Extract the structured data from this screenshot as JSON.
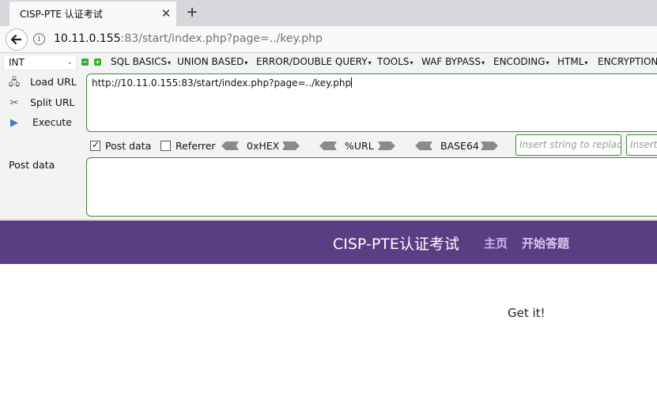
{
  "browser": {
    "tab_title": "CISP-PTE 认证考试",
    "tab_close": "✕",
    "new_tab": "+",
    "url_host": "10.11.0.155",
    "url_rest": ":83/start/index.php?page=../key.php",
    "info_glyph": "i"
  },
  "hackbar": {
    "select_value": "INT",
    "menus": [
      "SQL BASICS",
      "UNION BASED",
      "ERROR/DOUBLE QUERY",
      "TOOLS",
      "WAF BYPASS",
      "ENCODING",
      "HTML",
      "ENCRYPTION"
    ],
    "load_url": "Load URL",
    "split_url": "Split URL",
    "execute": "Execute",
    "url_value": "http://10.11.0.155:83/start/index.php?page=../key.php",
    "post_data_checkbox": "Post data",
    "post_data_checked": true,
    "referrer_checkbox": "Referrer",
    "referrer_checked": false,
    "encoders": [
      "0xHEX",
      "%URL",
      "BASE64"
    ],
    "replace_placeholder": "Insert string to replace",
    "replace_with_placeholder": "Insert",
    "post_data_label": "Post data",
    "post_data_value": ""
  },
  "site": {
    "brand": "CISP-PTE认证考试",
    "nav": [
      "主页",
      "开始答题"
    ],
    "header_color": "#5a3d82",
    "result_text": "Get it!"
  },
  "icons": {
    "back": "back-arrow-icon",
    "info": "info-icon",
    "load": "load-url-icon",
    "split": "split-url-icon",
    "execute": "execute-icon"
  }
}
